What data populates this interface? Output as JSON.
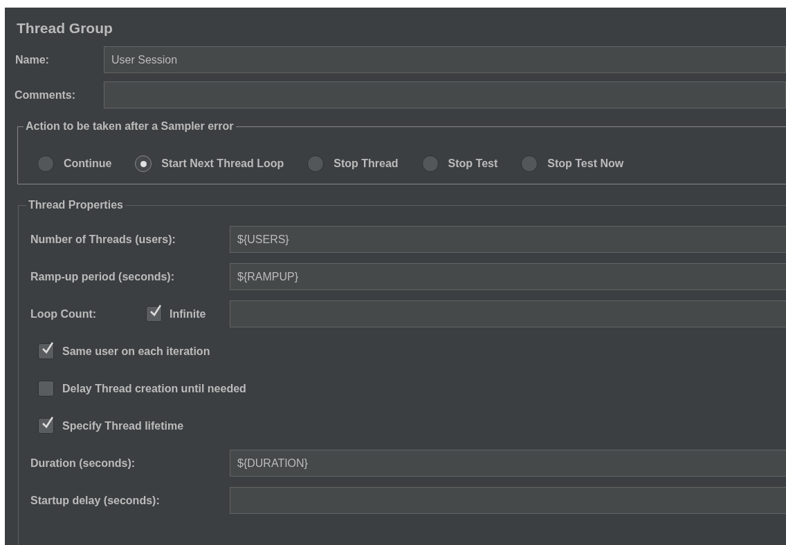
{
  "panel": {
    "title": "Thread Group"
  },
  "name_field": {
    "label": "Name:",
    "value": "User Session"
  },
  "comments_field": {
    "label": "Comments:"
  },
  "error_action": {
    "legend": "Action to be taken after a Sampler error",
    "options": [
      {
        "label": "Continue",
        "selected": false
      },
      {
        "label": "Start Next Thread Loop",
        "selected": true
      },
      {
        "label": "Stop Thread",
        "selected": false
      },
      {
        "label": "Stop Test",
        "selected": false
      },
      {
        "label": "Stop Test Now",
        "selected": false
      }
    ]
  },
  "thread_properties": {
    "legend": "Thread Properties",
    "rows": [
      {
        "kind": "field",
        "label": "Number of Threads (users):",
        "value": "${USERS}"
      },
      {
        "kind": "field",
        "label": "Ramp-up period (seconds):",
        "value": "${RAMPUP}"
      },
      {
        "kind": "loop",
        "label": "Loop Count:",
        "checkbox": {
          "label": "Infinite",
          "checked": true
        }
      },
      {
        "kind": "checkbox",
        "label": "Same user on each iteration",
        "checked": true
      },
      {
        "kind": "checkbox",
        "label": "Delay Thread creation until needed",
        "checked": false
      },
      {
        "kind": "checkbox",
        "label": "Specify Thread lifetime",
        "checked": true
      },
      {
        "kind": "field",
        "label": "Duration (seconds):",
        "value": "${DURATION}"
      },
      {
        "kind": "field",
        "label": "Startup delay (seconds):"
      }
    ]
  }
}
